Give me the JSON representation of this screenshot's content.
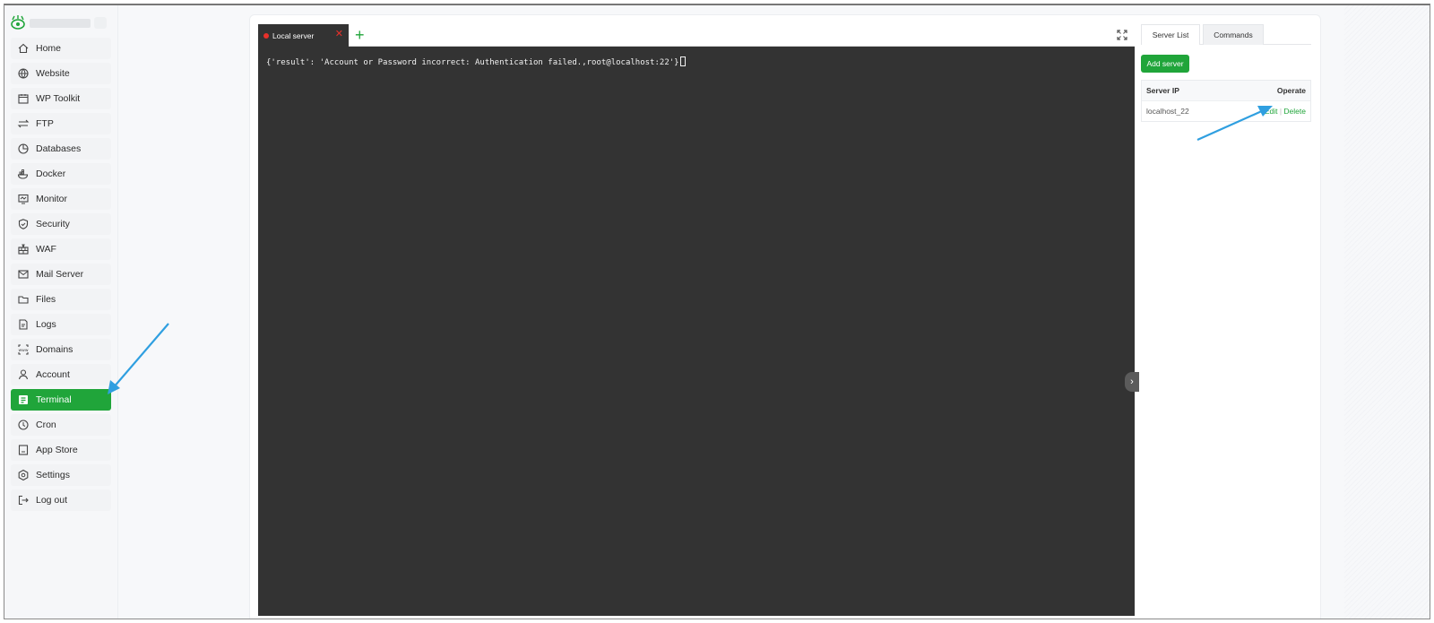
{
  "sidebar": {
    "items": [
      {
        "label": "Home",
        "icon": "home-icon"
      },
      {
        "label": "Website",
        "icon": "globe-icon"
      },
      {
        "label": "WP Toolkit",
        "icon": "calendar-icon"
      },
      {
        "label": "FTP",
        "icon": "transfer-icon"
      },
      {
        "label": "Databases",
        "icon": "database-icon"
      },
      {
        "label": "Docker",
        "icon": "docker-icon"
      },
      {
        "label": "Monitor",
        "icon": "monitor-icon"
      },
      {
        "label": "Security",
        "icon": "shield-icon"
      },
      {
        "label": "WAF",
        "icon": "firewall-icon"
      },
      {
        "label": "Mail Server",
        "icon": "mail-icon"
      },
      {
        "label": "Files",
        "icon": "folder-icon"
      },
      {
        "label": "Logs",
        "icon": "log-icon"
      },
      {
        "label": "Domains",
        "icon": "domain-icon"
      },
      {
        "label": "Account",
        "icon": "user-icon"
      },
      {
        "label": "Terminal",
        "icon": "terminal-icon",
        "active": true
      },
      {
        "label": "Cron",
        "icon": "clock-icon"
      },
      {
        "label": "App Store",
        "icon": "store-icon"
      },
      {
        "label": "Settings",
        "icon": "settings-icon"
      },
      {
        "label": "Log out",
        "icon": "logout-icon"
      }
    ]
  },
  "terminal": {
    "tab_label": "Local server",
    "output": "{'result': 'Account or Password incorrect: Authentication failed.,root@localhost:22'}"
  },
  "right_panel": {
    "tabs": [
      "Server List",
      "Commands"
    ],
    "add_server_label": "Add server",
    "table": {
      "headers": [
        "Server IP",
        "Operate"
      ],
      "rows": [
        {
          "ip": "localhost_22",
          "actions": [
            "Edit",
            "Delete"
          ]
        }
      ]
    }
  },
  "colors": {
    "accent": "#20a53a",
    "terminal_bg": "#333333",
    "annotation_arrow": "#2f9fe0"
  }
}
